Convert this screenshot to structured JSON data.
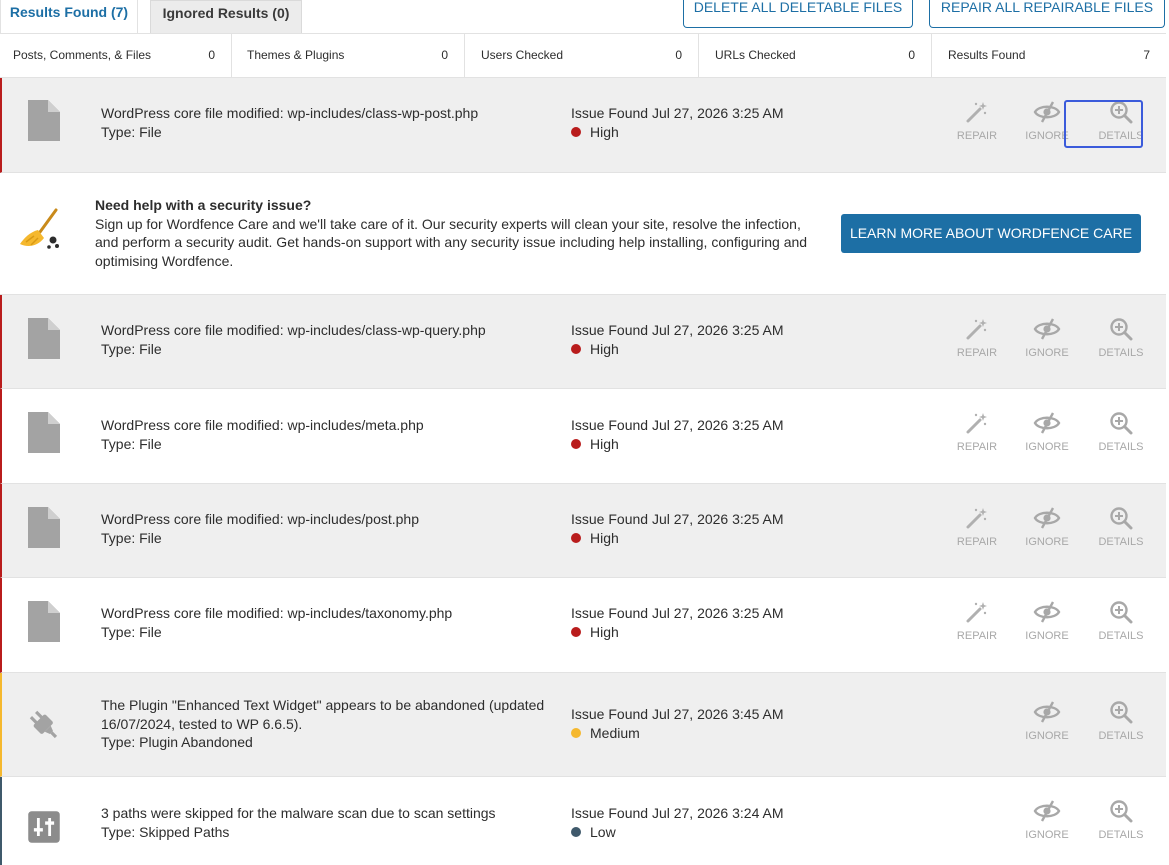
{
  "tabs": [
    {
      "label": "Results Found (7)",
      "active": true
    },
    {
      "label": "Ignored Results (0)",
      "active": false
    }
  ],
  "actions": {
    "delete_all": "DELETE ALL DELETABLE FILES",
    "repair_all": "REPAIR ALL REPAIRABLE FILES"
  },
  "summary": [
    {
      "label": "Posts, Comments, & Files",
      "value": "0"
    },
    {
      "label": "Themes & Plugins",
      "value": "0"
    },
    {
      "label": "Users Checked",
      "value": "0"
    },
    {
      "label": "URLs Checked",
      "value": "0"
    },
    {
      "label": "Results Found",
      "value": "7"
    }
  ],
  "action_labels": {
    "repair": "REPAIR",
    "ignore": "IGNORE",
    "details": "DETAILS"
  },
  "issues": [
    {
      "title": "WordPress core file modified: wp-includes/class-wp-post.php",
      "type": "Type: File",
      "found": "Issue Found Jul 27, 2026 3:25 AM",
      "severity": "High",
      "icon": "file-icon"
    },
    {
      "title": "WordPress core file modified: wp-includes/class-wp-query.php",
      "type": "Type: File",
      "found": "Issue Found Jul 27, 2026 3:25 AM",
      "severity": "High",
      "icon": "file-icon"
    },
    {
      "title": "WordPress core file modified: wp-includes/meta.php",
      "type": "Type: File",
      "found": "Issue Found Jul 27, 2026 3:25 AM",
      "severity": "High",
      "icon": "file-icon"
    },
    {
      "title": "WordPress core file modified: wp-includes/post.php",
      "type": "Type: File",
      "found": "Issue Found Jul 27, 2026 3:25 AM",
      "severity": "High",
      "icon": "file-icon"
    },
    {
      "title": "WordPress core file modified: wp-includes/taxonomy.php",
      "type": "Type: File",
      "found": "Issue Found Jul 27, 2026 3:25 AM",
      "severity": "High",
      "icon": "file-icon"
    },
    {
      "title": "The Plugin \"Enhanced Text Widget\" appears to be abandoned (updated 16/07/2024, tested to WP 6.6.5).",
      "type": "Type: Plugin Abandoned",
      "found": "Issue Found Jul 27, 2026 3:45 AM",
      "severity": "Medium",
      "icon": "plug-icon"
    },
    {
      "title": "3 paths were skipped for the malware scan due to scan settings",
      "type": "Type: Skipped Paths",
      "found": "Issue Found Jul 27, 2026 3:24 AM",
      "severity": "Low",
      "icon": "sliders-icon"
    }
  ],
  "promo": {
    "heading": "Need help with a security issue?",
    "body": "Sign up for Wordfence Care and we'll take care of it. Our security experts will clean your site, resolve the infection, and perform a security audit. Get hands-on support with any security issue including help installing, configuring and optimising Wordfence.",
    "button": "LEARN MORE ABOUT WORDFENCE CARE",
    "icon": "broom-icon"
  },
  "colors": {
    "accent": "#1d6fa5",
    "high": "#b91c1c",
    "medium": "#f5b82e",
    "low": "#3f596b"
  }
}
